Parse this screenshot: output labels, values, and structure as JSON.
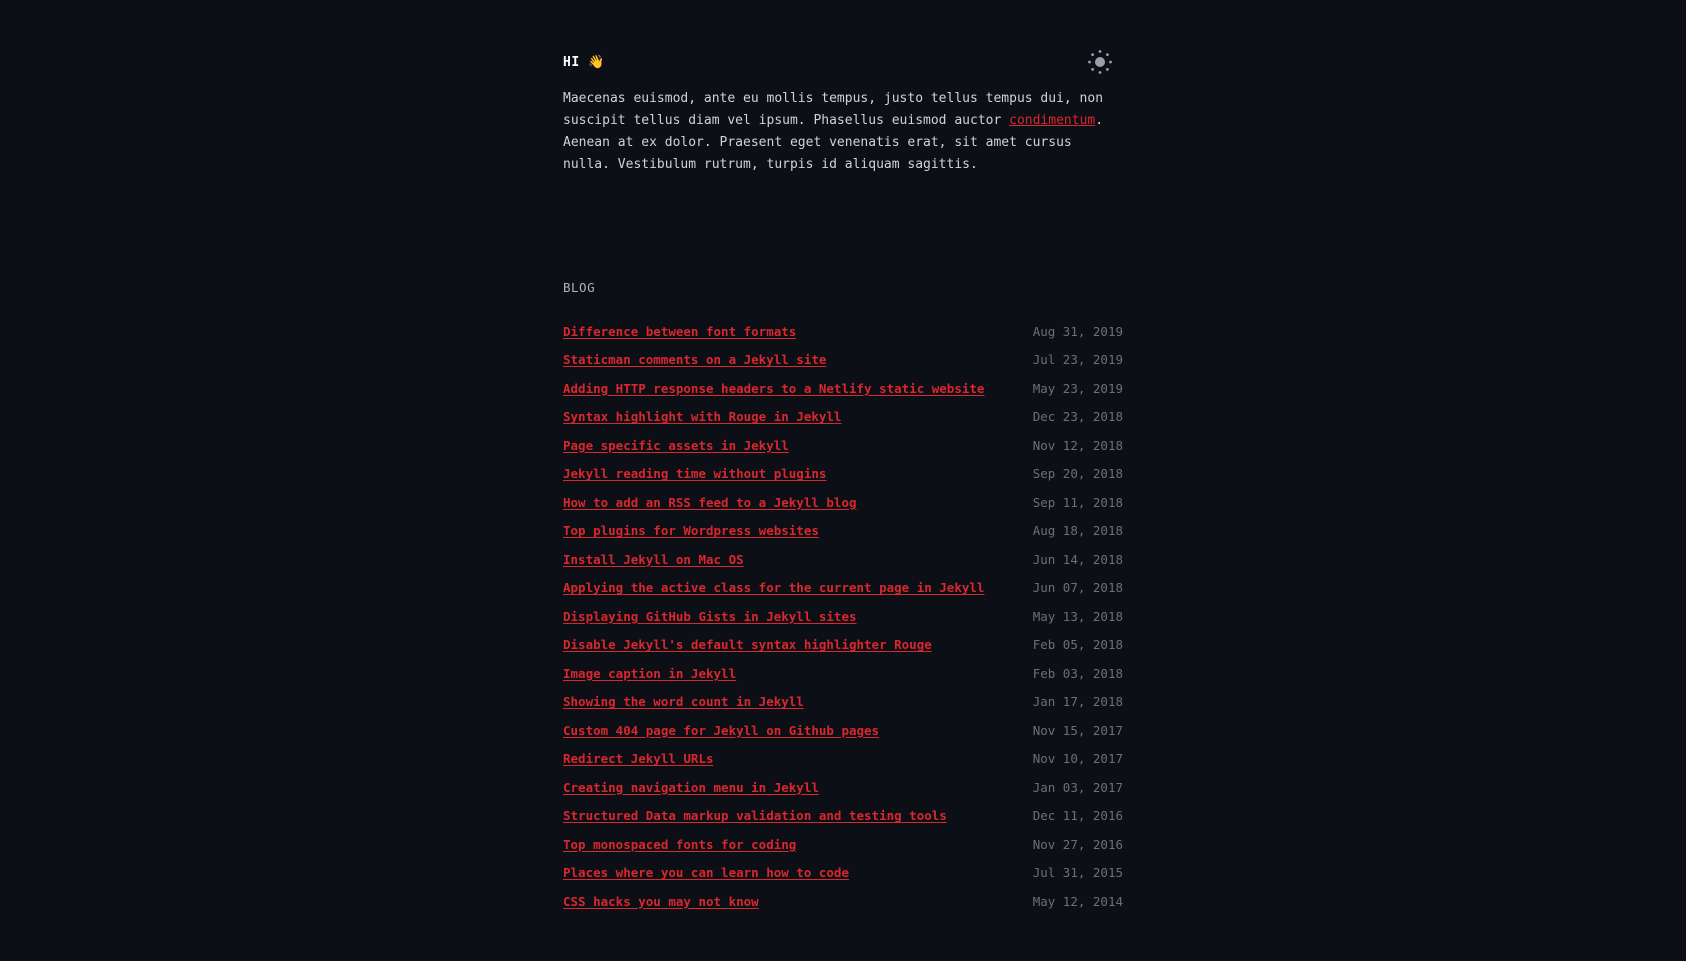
{
  "header": {
    "greeting": "HI 👋",
    "theme_toggle_icon": "sun-icon"
  },
  "intro": {
    "text_before": "Maecenas euismod, ante eu mollis tempus, justo tellus tempus dui, non suscipit tellus diam vel ipsum. Phasellus euismod auctor ",
    "link_text": "condimentum",
    "text_after": ". Aenean at ex dolor. Praesent eget venenatis erat, sit amet cursus nulla. Vestibulum rutrum, turpis id aliquam sagittis."
  },
  "blog": {
    "heading": "BLOG",
    "posts": [
      {
        "title": "Difference between font formats",
        "date": "Aug 31, 2019"
      },
      {
        "title": "Staticman comments on a Jekyll site",
        "date": "Jul 23, 2019"
      },
      {
        "title": "Adding HTTP response headers to a Netlify static website",
        "date": "May 23, 2019"
      },
      {
        "title": "Syntax highlight with Rouge in Jekyll",
        "date": "Dec 23, 2018"
      },
      {
        "title": "Page specific assets in Jekyll",
        "date": "Nov 12, 2018"
      },
      {
        "title": "Jekyll reading time without plugins",
        "date": "Sep 20, 2018"
      },
      {
        "title": "How to add an RSS feed to a Jekyll blog",
        "date": "Sep 11, 2018"
      },
      {
        "title": "Top plugins for Wordpress websites",
        "date": "Aug 18, 2018"
      },
      {
        "title": "Install Jekyll on Mac OS",
        "date": "Jun 14, 2018"
      },
      {
        "title": "Applying the active class for the current page in Jekyll",
        "date": "Jun 07, 2018"
      },
      {
        "title": "Displaying GitHub Gists in Jekyll sites",
        "date": "May 13, 2018"
      },
      {
        "title": "Disable Jekyll's default syntax highlighter Rouge",
        "date": "Feb 05, 2018"
      },
      {
        "title": "Image caption in Jekyll",
        "date": "Feb 03, 2018"
      },
      {
        "title": "Showing the word count in Jekyll",
        "date": "Jan 17, 2018"
      },
      {
        "title": "Custom 404 page for Jekyll on Github pages",
        "date": "Nov 15, 2017"
      },
      {
        "title": "Redirect Jekyll URLs",
        "date": "Nov 10, 2017"
      },
      {
        "title": "Creating navigation menu in Jekyll",
        "date": "Jan 03, 2017"
      },
      {
        "title": "Structured Data markup validation and testing tools",
        "date": "Dec 11, 2016"
      },
      {
        "title": "Top monospaced fonts for coding",
        "date": "Nov 27, 2016"
      },
      {
        "title": "Places where you can learn how to code",
        "date": "Jul 31, 2015"
      },
      {
        "title": "CSS hacks you may not know",
        "date": "May 12, 2014"
      }
    ]
  },
  "colors": {
    "background": "#0c0f16",
    "link": "#d9272e",
    "date": "#6b6f78"
  }
}
